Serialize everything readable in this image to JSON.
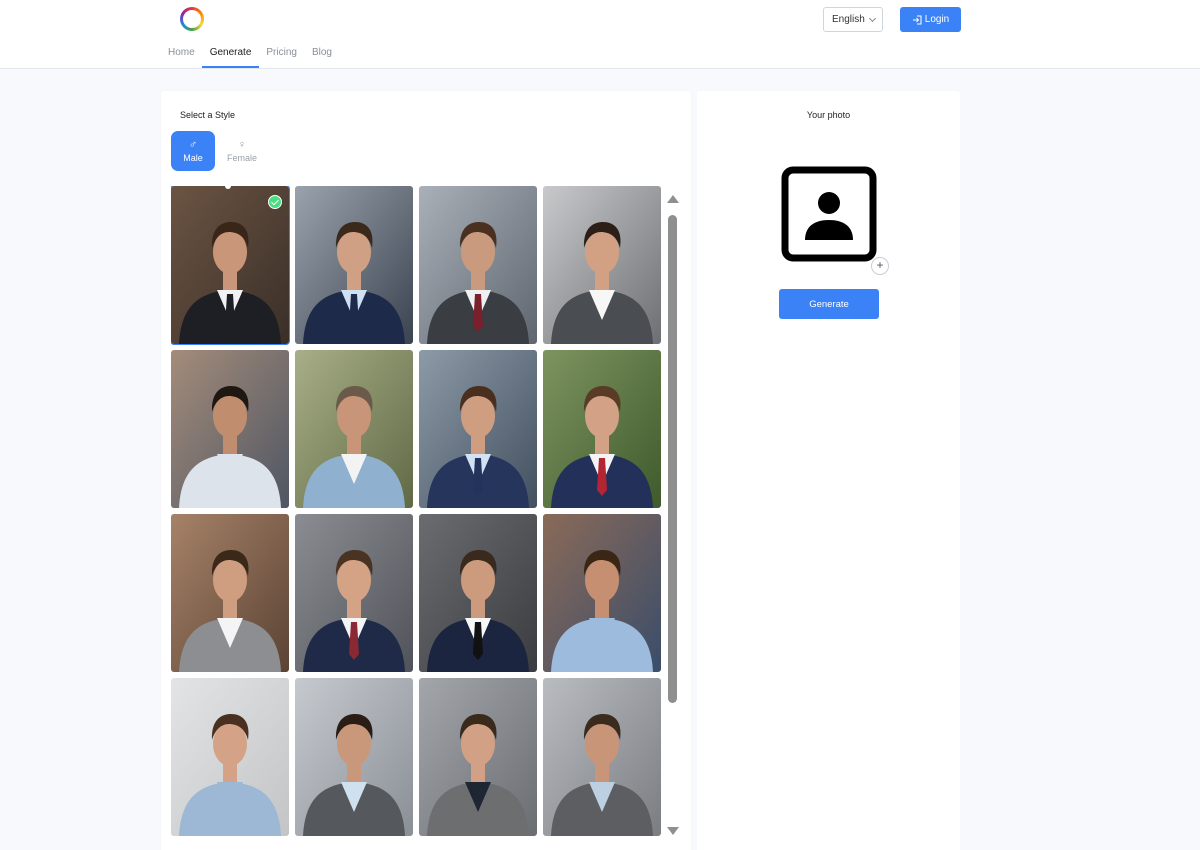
{
  "header": {
    "language": "English",
    "login_label": "Login",
    "nav": [
      "Home",
      "Generate",
      "Pricing",
      "Blog"
    ],
    "active_nav": "Generate"
  },
  "style_panel": {
    "title": "Select a Style",
    "genders": [
      {
        "label": "Male",
        "glyph": "♂",
        "selected": true
      },
      {
        "label": "Female",
        "glyph": "♀",
        "selected": false
      }
    ],
    "styles": [
      {
        "bg": "#3a2f28",
        "bg2": "#6b5443",
        "suit": "#1d1f24",
        "shirt": "#f2f2f2",
        "tie": "#1d1f24",
        "hair": "#3a2618",
        "skin": "#c9967a"
      },
      {
        "bg": "#3b4350",
        "bg2": "#9aa3ad",
        "suit": "#1e2a4a",
        "shirt": "#cfe0f2",
        "tie": "#1e2a4a",
        "hair": "#3b2a1c",
        "skin": "#d0a084"
      },
      {
        "bg": "#5e6670",
        "bg2": "#a9b0b8",
        "suit": "#3a3d42",
        "shirt": "#eef0f2",
        "tie": "#7a1f2c",
        "hair": "#4a3020",
        "skin": "#c99a7e"
      },
      {
        "bg": "#6d6f73",
        "bg2": "#c8c9cb",
        "suit": "#4a4d52",
        "shirt": "#f7f7f7",
        "tie": "",
        "hair": "#2b1f18",
        "skin": "#d2a184"
      },
      {
        "bg": "#4f5663",
        "bg2": "#a48c7a",
        "suit": "#dde3ea",
        "shirt": "#dde3ea",
        "tie": "",
        "hair": "#1f1712",
        "skin": "#c08d6e"
      },
      {
        "bg": "#5f6a44",
        "bg2": "#a8ae88",
        "suit": "#8fb0cf",
        "shirt": "#f3f3f3",
        "tie": "",
        "hair": "#6b5a4a",
        "skin": "#c99579"
      },
      {
        "bg": "#43505f",
        "bg2": "#8d9aa8",
        "suit": "#25355c",
        "shirt": "#d3e2f3",
        "tie": "#23345c",
        "hair": "#4a2f1e",
        "skin": "#cf9d80"
      },
      {
        "bg": "#3f5a2c",
        "bg2": "#7d9460",
        "suit": "#22305a",
        "shirt": "#f4f4f4",
        "tie": "#b32532",
        "hair": "#5a3b26",
        "skin": "#d3a286"
      },
      {
        "bg": "#5b4334",
        "bg2": "#a68268",
        "suit": "#8c8e92",
        "shirt": "#f4f4f4",
        "tie": "",
        "hair": "#3a2818",
        "skin": "#cf9e80"
      },
      {
        "bg": "#505359",
        "bg2": "#8a8d92",
        "suit": "#1e2a48",
        "shirt": "#f4f4f4",
        "tie": "#8a2834",
        "hair": "#4a3322",
        "skin": "#d4a385"
      },
      {
        "bg": "#3a3c40",
        "bg2": "#6a6c70",
        "suit": "#1c2540",
        "shirt": "#f7f7f7",
        "tie": "#111111",
        "hair": "#3a2a1e",
        "skin": "#cc9a7c"
      },
      {
        "bg": "#3a4d6a",
        "bg2": "#8a6a58",
        "suit": "#9dbbdd",
        "shirt": "#9dbbdd",
        "tie": "",
        "hair": "#3b2616",
        "skin": "#c78f72"
      },
      {
        "bg": "#c2c4c6",
        "bg2": "#e3e4e5",
        "suit": "#9cb8d4",
        "shirt": "#9cb8d4",
        "tie": "",
        "hair": "#4a3020",
        "skin": "#d4a286"
      },
      {
        "bg": "#8a8f96",
        "bg2": "#c6cacf",
        "suit": "#55585d",
        "shirt": "#cfe0ef",
        "tie": "",
        "hair": "#2a1d15",
        "skin": "#c9987a"
      },
      {
        "bg": "#6a6d72",
        "bg2": "#a3a6aa",
        "suit": "#6d6e70",
        "shirt": "#1f2633",
        "tie": "",
        "hair": "#3a2a1c",
        "skin": "#d2a084"
      },
      {
        "bg": "#7a7d82",
        "bg2": "#b9bcc0",
        "suit": "#5c5e62",
        "shirt": "#bcd0e2",
        "tie": "",
        "hair": "#3b2a1e",
        "skin": "#c99579"
      }
    ]
  },
  "photo_panel": {
    "title": "Your photo",
    "add_symbol": "+",
    "generate_label": "Generate"
  }
}
